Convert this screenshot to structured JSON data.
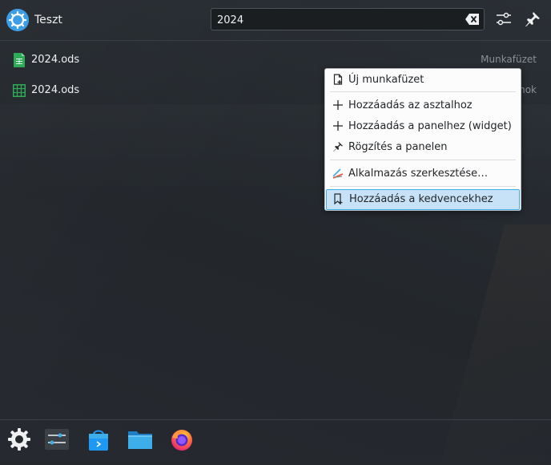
{
  "header": {
    "user_name": "Teszt",
    "search_value": "2024",
    "icons": [
      "kde-logo-icon",
      "clear-search-icon",
      "configure-icon",
      "pin-icon"
    ]
  },
  "results": [
    {
      "name": "2024.ods",
      "category": "Munkafüzet",
      "icon": "spreadsheet-file-icon"
    },
    {
      "name": "2024.ods",
      "category": "Dokumentumok",
      "category_visible": "nok",
      "icon": "spreadsheet-grid-icon"
    }
  ],
  "context_menu": {
    "items": [
      {
        "label": "Új munkafüzet",
        "icon": "new-document-icon"
      },
      {
        "label": "Hozzáadás az asztalhoz",
        "icon": "plus-icon"
      },
      {
        "label": "Hozzáadás a panelhez (widget)",
        "icon": "plus-icon"
      },
      {
        "label": "Rögzítés a panelen",
        "icon": "pin-icon"
      },
      {
        "label": "Alkalmazás szerkesztése…",
        "icon": "edit-app-icon"
      },
      {
        "label": "Hozzáadás a kedvencekhez",
        "icon": "bookmark-add-icon"
      }
    ],
    "highlighted_index": 5
  },
  "bottom_bar": {
    "apps": [
      "system-settings-icon",
      "mixer-settings-icon",
      "discover-store-icon",
      "file-manager-icon",
      "firefox-icon"
    ]
  },
  "colors": {
    "accent": "#3daee9",
    "highlight": "#c7e2f6",
    "background": "#25292e"
  }
}
